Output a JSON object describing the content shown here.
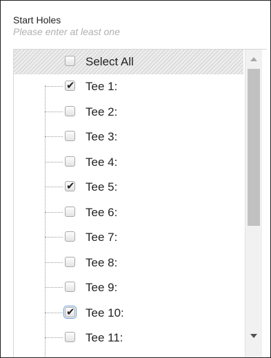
{
  "field": {
    "title": "Start Holes",
    "hint": "Please enter at least one"
  },
  "select_all": {
    "label": "Select All",
    "checked": false
  },
  "items": [
    {
      "label": "Tee 1:",
      "checked": true
    },
    {
      "label": "Tee 2:",
      "checked": false
    },
    {
      "label": "Tee 3:",
      "checked": false
    },
    {
      "label": "Tee 4:",
      "checked": false
    },
    {
      "label": "Tee 5:",
      "checked": true
    },
    {
      "label": "Tee 6:",
      "checked": false
    },
    {
      "label": "Tee 7:",
      "checked": false
    },
    {
      "label": "Tee 8:",
      "checked": false
    },
    {
      "label": "Tee 9:",
      "checked": false
    },
    {
      "label": "Tee 10:",
      "checked": true,
      "focused": true
    },
    {
      "label": "Tee 11:",
      "checked": false
    }
  ],
  "icons": {
    "scroll_up": "triangle-up-icon",
    "scroll_down": "triangle-down-icon",
    "checkmark": "checkmark-icon"
  },
  "colors": {
    "border": "#1e1e1e",
    "hint_text": "#b0b0b0",
    "focus_outline": "#6a9cd6",
    "scroll_thumb": "#c1c1c1"
  }
}
